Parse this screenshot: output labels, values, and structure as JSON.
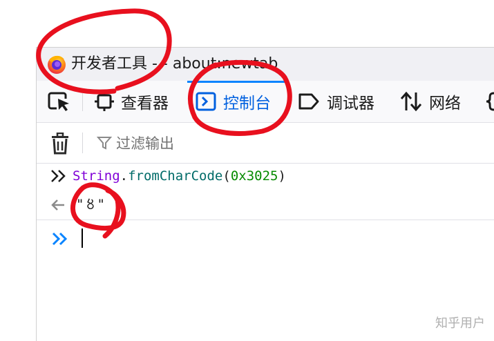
{
  "window": {
    "title": "开发者工具 - - about:newtab"
  },
  "toolbar": {
    "tabs": [
      {
        "label": "查看器",
        "icon": "inspector-icon"
      },
      {
        "label": "控制台",
        "icon": "console-icon",
        "selected": true
      },
      {
        "label": "调试器",
        "icon": "debugger-icon"
      },
      {
        "label": "网络",
        "icon": "network-icon"
      }
    ],
    "picker_icon": "element-picker-icon"
  },
  "filterbar": {
    "clear_icon": "trash-icon",
    "filter_placeholder": "过滤输出"
  },
  "console": {
    "input_code": {
      "object": "String",
      "dot": ".",
      "method": "fromCharCode",
      "open_paren": "(",
      "argument": "0x3025",
      "close_paren": ")"
    },
    "output_value": "\"〥\""
  },
  "watermark": "知乎用户",
  "colors": {
    "accent": "#0060df",
    "annotation": "#e8101e"
  }
}
